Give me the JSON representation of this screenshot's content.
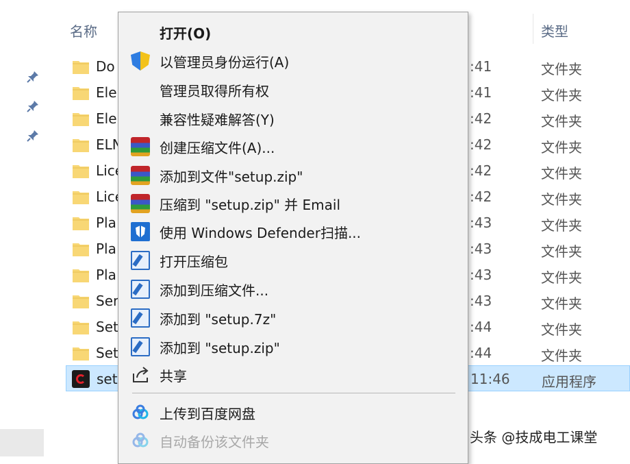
{
  "header": {
    "name_col": "名称",
    "type_col": "类型"
  },
  "files": [
    {
      "name": "Do",
      "time": ":41",
      "type": "文件夹",
      "icon": "folder-icon"
    },
    {
      "name": "Ele",
      "time": ":41",
      "type": "文件夹",
      "icon": "folder-icon"
    },
    {
      "name": "Ele",
      "time": ":42",
      "type": "文件夹",
      "icon": "folder-icon"
    },
    {
      "name": "ELN",
      "time": ":42",
      "type": "文件夹",
      "icon": "folder-icon"
    },
    {
      "name": "Lice",
      "time": ":42",
      "type": "文件夹",
      "icon": "folder-icon"
    },
    {
      "name": "Lice",
      "time": ":42",
      "type": "文件夹",
      "icon": "folder-icon"
    },
    {
      "name": "Pla",
      "time": ":43",
      "type": "文件夹",
      "icon": "folder-icon"
    },
    {
      "name": "Pla",
      "time": ":43",
      "type": "文件夹",
      "icon": "folder-icon"
    },
    {
      "name": "Pla",
      "time": ":43",
      "type": "文件夹",
      "icon": "folder-icon"
    },
    {
      "name": "Ser",
      "time": ":43",
      "type": "文件夹",
      "icon": "folder-icon"
    },
    {
      "name": "Set",
      "time": ":44",
      "type": "文件夹",
      "icon": "folder-icon"
    },
    {
      "name": "Set",
      "time": ":44",
      "type": "文件夹",
      "icon": "folder-icon"
    },
    {
      "name": "set",
      "time": "11:46",
      "type": "应用程序",
      "icon": "app-icon",
      "selected": true
    }
  ],
  "menu": {
    "items": [
      {
        "label": "打开(O)",
        "icon": "none",
        "bold": true
      },
      {
        "label": "以管理员身份运行(A)",
        "icon": "uac-shield-icon"
      },
      {
        "label": "管理员取得所有权",
        "icon": "none"
      },
      {
        "label": "兼容性疑难解答(Y)",
        "icon": "none"
      },
      {
        "label": "创建压缩文件(A)...",
        "icon": "winrar-icon"
      },
      {
        "label": "添加到文件\"setup.zip\"",
        "icon": "winrar-icon"
      },
      {
        "label": "压缩到 \"setup.zip\" 并 Email",
        "icon": "winrar-icon"
      },
      {
        "label": "使用 Windows Defender扫描...",
        "icon": "windows-defender-icon"
      },
      {
        "label": "打开压缩包",
        "icon": "7zip-icon"
      },
      {
        "label": "添加到压缩文件...",
        "icon": "7zip-icon"
      },
      {
        "label": "添加到 \"setup.7z\"",
        "icon": "7zip-icon"
      },
      {
        "label": "添加到 \"setup.zip\"",
        "icon": "7zip-icon"
      },
      {
        "label": "共享",
        "icon": "share-icon"
      },
      {
        "label": "上传到百度网盘",
        "icon": "baidu-netdisk-icon"
      },
      {
        "label": "自动备份该文件夹",
        "icon": "baidu-netdisk-icon",
        "disabled": true
      }
    ]
  },
  "watermark": "头条 @技成电工课堂",
  "colors": {
    "selection": "#cce8ff",
    "menu_bg": "#f2f2f2",
    "folder": "#f8d775"
  }
}
